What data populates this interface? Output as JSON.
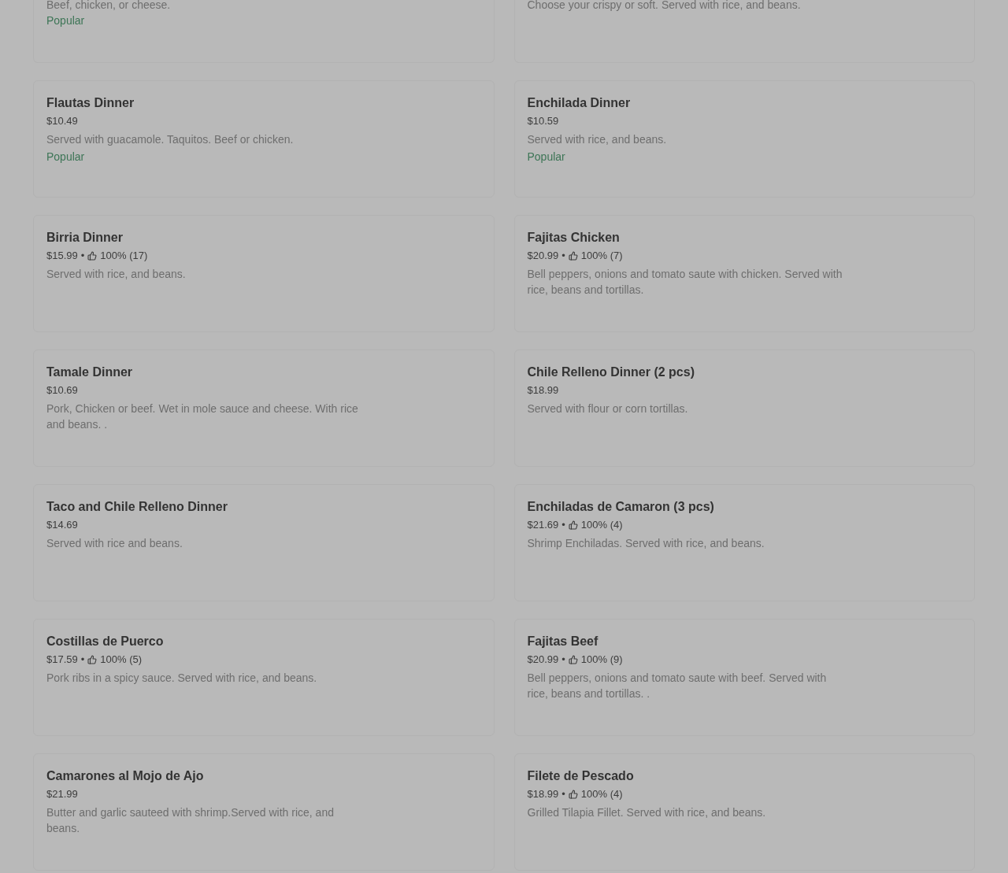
{
  "partial_row": [
    {
      "description": "Beef, chicken, or cheese.",
      "badge": "Popular"
    },
    {
      "description": "Choose your crispy or soft. Served with rice, and beans."
    }
  ],
  "items": [
    {
      "name": "Flautas Dinner",
      "price": "$10.49",
      "description": "Served with guacamole. Taquitos. Beef or chicken.",
      "badge": "Popular"
    },
    {
      "name": "Enchilada Dinner",
      "price": "$10.59",
      "description": "Served with rice, and beans.",
      "badge": "Popular"
    },
    {
      "name": "Birria Dinner",
      "price": "$15.99",
      "rating": {
        "separator": "•",
        "percent": "100%",
        "count": "(17)"
      },
      "description": "Served with rice, and beans."
    },
    {
      "name": "Fajitas Chicken",
      "price": "$20.99",
      "rating": {
        "separator": "•",
        "percent": "100%",
        "count": "(7)"
      },
      "description": "Bell peppers, onions and tomato saute with chicken. Served with rice, beans and tortillas."
    },
    {
      "name": "Tamale Dinner",
      "price": "$10.69",
      "description": "Pork, Chicken or beef. Wet in mole sauce and cheese. With rice and beans. ."
    },
    {
      "name": "Chile Relleno Dinner (2 pcs)",
      "price": "$18.99",
      "description": "Served with flour or corn tortillas."
    },
    {
      "name": "Taco and Chile Relleno Dinner",
      "price": "$14.69",
      "description": "Served with rice and beans."
    },
    {
      "name": "Enchiladas de Camaron (3 pcs)",
      "price": "$21.69",
      "rating": {
        "separator": "•",
        "percent": "100%",
        "count": "(4)"
      },
      "description": "Shrimp Enchiladas. Served with rice, and beans."
    },
    {
      "name": "Costillas de Puerco",
      "price": "$17.59",
      "rating": {
        "separator": "•",
        "percent": "100%",
        "count": "(5)"
      },
      "description": "Pork ribs in a spicy sauce. Served with rice, and beans."
    },
    {
      "name": "Fajitas Beef",
      "price": "$20.99",
      "rating": {
        "separator": "•",
        "percent": "100%",
        "count": "(9)"
      },
      "description": "Bell peppers, onions and tomato saute with beef. Served with rice, beans and tortillas. ."
    },
    {
      "name": "Camarones al Mojo de Ajo",
      "price": "$21.99",
      "description": "Butter and garlic sauteed with shrimp.Served with rice, and beans."
    },
    {
      "name": "Filete de Pescado",
      "price": "$18.99",
      "rating": {
        "separator": "•",
        "percent": "100%",
        "count": "(4)"
      },
      "description": "Grilled Tilapia Fillet. Served with rice, and beans."
    }
  ]
}
